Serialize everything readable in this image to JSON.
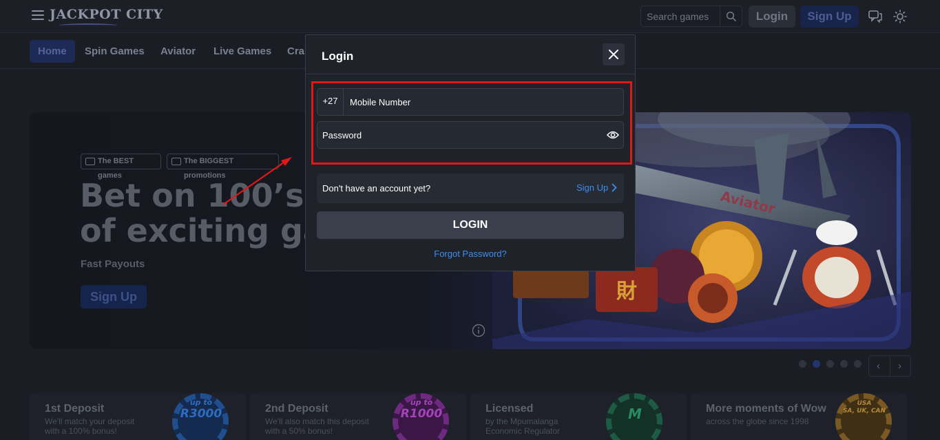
{
  "header": {
    "logo_text": "JACKPOT CITY",
    "search_placeholder": "Search games",
    "login_label": "Login",
    "signup_label": "Sign Up"
  },
  "nav": {
    "items": [
      {
        "label": "Home",
        "active": true
      },
      {
        "label": "Spin Games"
      },
      {
        "label": "Aviator"
      },
      {
        "label": "Live Games"
      },
      {
        "label": "Cras"
      }
    ]
  },
  "hero": {
    "tag1": "The BEST games",
    "tag2": "The BIGGEST promotions",
    "title_line1": "Bet on 100’s",
    "title_line2": "of exciting ga",
    "subtitle": "Fast Payouts",
    "cta_label": "Sign Up",
    "slides_total": 5,
    "active_slide": 2,
    "prev_label": "‹",
    "next_label": "›"
  },
  "promos": [
    {
      "title": "1st Deposit",
      "line1": "We'll match your deposit",
      "line2": "with a 100% bonus!",
      "chip_top": "up to",
      "chip_value": "R3000"
    },
    {
      "title": "2nd Deposit",
      "line1": "We'll also match this deposit",
      "line2": "with a 50% bonus!",
      "chip_top": "up to",
      "chip_value": "R1000"
    },
    {
      "title": "Licensed",
      "line1": "by the Mpumalanga",
      "line2": "Economic Regulator",
      "chip_top": "",
      "chip_value": "M"
    },
    {
      "title": "More moments of Wow",
      "line1": "across the globe since 1998",
      "line2": "",
      "chip_top": "USA",
      "chip_value": "SA, UK, CAN"
    }
  ],
  "modal": {
    "title": "Login",
    "phone_prefix": "+27",
    "phone_placeholder": "Mobile Number",
    "password_placeholder": "Password",
    "no_account_text": "Don't have an account yet?",
    "signup_link": "Sign Up",
    "login_button": "LOGIN",
    "forgot_link": "Forgot Password?"
  },
  "colors": {
    "highlight": "#e01818",
    "link": "#3d8ef0",
    "modal_bg": "#1f2229"
  }
}
